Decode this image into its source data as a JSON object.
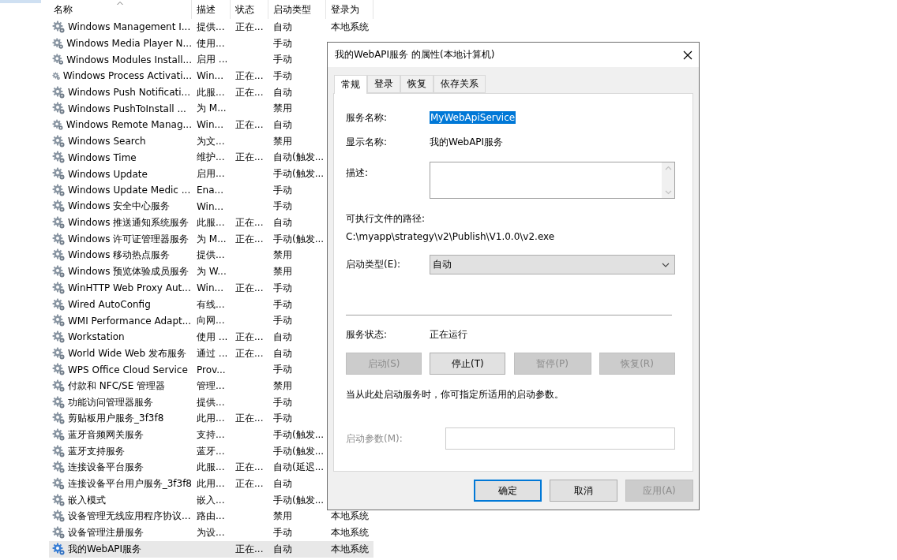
{
  "columns": [
    {
      "label": "名称",
      "sorted": true
    },
    {
      "label": "描述",
      "sorted": false
    },
    {
      "label": "状态",
      "sorted": false
    },
    {
      "label": "启动类型",
      "sorted": false
    },
    {
      "label": "登录为",
      "sorted": false
    }
  ],
  "services": [
    {
      "name": "Windows Management I...",
      "description": "提供...",
      "status": "正在...",
      "startup": "自动",
      "logon": "本地系统",
      "selected": false
    },
    {
      "name": "Windows Media Player N...",
      "description": "使用...",
      "startup": "手动",
      "selected": false
    },
    {
      "name": "Windows Modules Install...",
      "description": "启用 ...",
      "startup": "手动",
      "selected": false
    },
    {
      "name": "Windows Process Activati...",
      "description": "Win...",
      "status": "正在...",
      "startup": "手动",
      "selected": false
    },
    {
      "name": "Windows Push Notificati...",
      "description": "此服...",
      "status": "正在...",
      "startup": "自动",
      "selected": false
    },
    {
      "name": "Windows PushToInstall ...",
      "description": "为 M...",
      "startup": "禁用",
      "selected": false
    },
    {
      "name": "Windows Remote Manag...",
      "description": "Win...",
      "status": "正在...",
      "startup": "自动",
      "selected": false
    },
    {
      "name": "Windows Search",
      "description": "为文...",
      "startup": "禁用",
      "selected": false
    },
    {
      "name": "Windows Time",
      "description": "维护...",
      "status": "正在...",
      "startup": "自动(触发...",
      "selected": false
    },
    {
      "name": "Windows Update",
      "description": "启用...",
      "startup": "手动(触发...",
      "selected": false
    },
    {
      "name": "Windows Update Medic ...",
      "description": "Ena...",
      "startup": "手动",
      "selected": false
    },
    {
      "name": "Windows 安全中心服务",
      "description": "Win...",
      "startup": "手动",
      "selected": false
    },
    {
      "name": "Windows 推送通知系统服务",
      "description": "此服...",
      "status": "正在...",
      "startup": "自动",
      "selected": false
    },
    {
      "name": "Windows 许可证管理器服务",
      "description": "为 M...",
      "status": "正在...",
      "startup": "手动(触发...",
      "selected": false
    },
    {
      "name": "Windows 移动热点服务",
      "description": "提供...",
      "startup": "禁用",
      "selected": false
    },
    {
      "name": "Windows 预览体验成员服务",
      "description": "为 W...",
      "startup": "禁用",
      "selected": false
    },
    {
      "name": "WinHTTP Web Proxy Aut...",
      "description": "Win...",
      "status": "正在...",
      "startup": "手动",
      "selected": false
    },
    {
      "name": "Wired AutoConfig",
      "description": "有线...",
      "startup": "手动",
      "selected": false
    },
    {
      "name": "WMI Performance Adapt...",
      "description": "向网...",
      "startup": "手动",
      "selected": false
    },
    {
      "name": "Workstation",
      "description": "使用 ...",
      "status": "正在...",
      "startup": "自动",
      "selected": false
    },
    {
      "name": "World Wide Web 发布服务",
      "description": "通过 ...",
      "status": "正在...",
      "startup": "自动",
      "selected": false
    },
    {
      "name": "WPS Office Cloud Service",
      "description": "Prov...",
      "startup": "手动",
      "selected": false
    },
    {
      "name": "付款和 NFC/SE 管理器",
      "description": "管理...",
      "startup": "禁用",
      "selected": false
    },
    {
      "name": "功能访问管理器服务",
      "description": "提供...",
      "startup": "手动",
      "selected": false
    },
    {
      "name": "剪贴板用户服务_3f3f8",
      "description": "此用...",
      "status": "正在...",
      "startup": "手动",
      "selected": false
    },
    {
      "name": "蓝牙音频网关服务",
      "description": "支持...",
      "startup": "手动(触发...",
      "selected": false
    },
    {
      "name": "蓝牙支持服务",
      "description": "蓝牙...",
      "startup": "手动(触发...",
      "selected": false
    },
    {
      "name": "连接设备平台服务",
      "description": "此服...",
      "status": "正在...",
      "startup": "自动(延迟...",
      "selected": false
    },
    {
      "name": "连接设备平台用户服务_3f3f8",
      "description": "此用...",
      "status": "正在...",
      "startup": "自动",
      "selected": false
    },
    {
      "name": "嵌入模式",
      "description": "嵌入...",
      "startup": "手动(触发...",
      "selected": false
    },
    {
      "name": "设备管理无线应用程序协议...",
      "description": "路由...",
      "startup": "禁用",
      "logon": "本地系统",
      "selected": false
    },
    {
      "name": "设备管理注册服务",
      "description": "为设...",
      "startup": "手动",
      "logon": "本地系统",
      "selected": false
    },
    {
      "name": "我的WebAPI服务",
      "status": "正在...",
      "startup": "自动",
      "logon": "本地系统",
      "selected": true
    }
  ],
  "dialog": {
    "title": "我的WebAPI服务 的属性(本地计算机)",
    "tabs": [
      {
        "label": "常规",
        "selected": true
      },
      {
        "label": "登录",
        "selected": false
      },
      {
        "label": "恢复",
        "selected": false
      },
      {
        "label": "依存关系",
        "selected": false
      }
    ],
    "service_name": {
      "label": "服务名称:",
      "value": "MyWebApiService"
    },
    "display_name": {
      "label": "显示名称:",
      "value": "我的WebAPI服务"
    },
    "description": {
      "label": "描述:"
    },
    "executable_path": {
      "label": "可执行文件的路径:",
      "value": "C:\\myapp\\strategy\\v2\\Publish\\V1.0.0\\v2.exe"
    },
    "startup_type": {
      "label": "启动类型(E):",
      "value": "自动"
    },
    "service_status": {
      "label": "服务状态:",
      "value": "正在运行"
    },
    "control_buttons": [
      {
        "label": "启动(S)",
        "disabled": true
      },
      {
        "label": "停止(T)",
        "disabled": false
      },
      {
        "label": "暂停(P)",
        "disabled": true
      },
      {
        "label": "恢复(R)",
        "disabled": true
      }
    ],
    "hint": "当从此处启动服务时，你可指定所适用的启动参数。",
    "start_parameters": {
      "label": "启动参数(M):",
      "disabled": true
    },
    "footer_buttons": [
      {
        "label": "确定",
        "default": true,
        "disabled": false
      },
      {
        "label": "取消",
        "default": false,
        "disabled": false
      },
      {
        "label": "应用(A)",
        "default": false,
        "disabled": true
      }
    ]
  }
}
